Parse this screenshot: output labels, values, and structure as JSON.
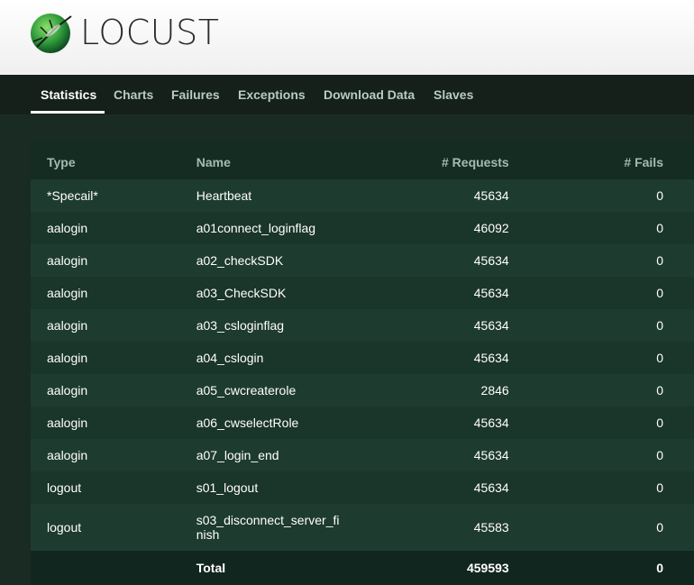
{
  "brand": {
    "logo_text": "LOCUST",
    "logo_icon": "locust-bug-logo-icon"
  },
  "nav": {
    "tabs": [
      {
        "label": "Statistics",
        "active": true
      },
      {
        "label": "Charts",
        "active": false
      },
      {
        "label": "Failures",
        "active": false
      },
      {
        "label": "Exceptions",
        "active": false
      },
      {
        "label": "Download Data",
        "active": false
      },
      {
        "label": "Slaves",
        "active": false
      }
    ]
  },
  "stats": {
    "headers": {
      "type": "Type",
      "name": "Name",
      "requests": "# Requests",
      "fails": "# Fails"
    },
    "rows": [
      {
        "type": "*Specail*",
        "name": "Heartbeat",
        "requests": "45634",
        "fails": "0"
      },
      {
        "type": "aalogin",
        "name": "a01connect_loginflag",
        "requests": "46092",
        "fails": "0"
      },
      {
        "type": "aalogin",
        "name": "a02_checkSDK",
        "requests": "45634",
        "fails": "0"
      },
      {
        "type": "aalogin",
        "name": "a03_CheckSDK",
        "requests": "45634",
        "fails": "0"
      },
      {
        "type": "aalogin",
        "name": "a03_csloginflag",
        "requests": "45634",
        "fails": "0"
      },
      {
        "type": "aalogin",
        "name": "a04_cslogin",
        "requests": "45634",
        "fails": "0"
      },
      {
        "type": "aalogin",
        "name": "a05_cwcreaterole",
        "requests": "2846",
        "fails": "0"
      },
      {
        "type": "aalogin",
        "name": "a06_cwselectRole",
        "requests": "45634",
        "fails": "0"
      },
      {
        "type": "aalogin",
        "name": "a07_login_end",
        "requests": "45634",
        "fails": "0"
      },
      {
        "type": "logout",
        "name": "s01_logout",
        "requests": "45634",
        "fails": "0"
      },
      {
        "type": "logout",
        "name": "s03_disconnect_server_finish",
        "requests": "45583",
        "fails": "0"
      }
    ],
    "total": {
      "label": "Total",
      "requests": "459593",
      "fails": "0"
    }
  },
  "colors": {
    "page_bg": "#1a2b24",
    "nav_bg": "#142019",
    "table_bg": "#1c3a2e",
    "header_text": "#a3bbb0",
    "active_tab": "#ffffff"
  }
}
